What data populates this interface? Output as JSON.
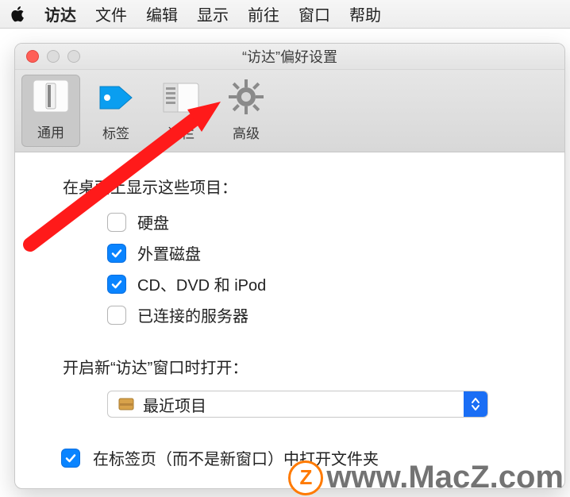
{
  "menubar": {
    "app": "访达",
    "items": [
      "文件",
      "编辑",
      "显示",
      "前往",
      "窗口",
      "帮助"
    ]
  },
  "window": {
    "title": "“访达”偏好设置"
  },
  "toolbar": {
    "general": "通用",
    "tags": "标签",
    "sidebar": "边栏",
    "advanced": "高级"
  },
  "desktop": {
    "heading": "在桌面上显示这些项目：",
    "items": [
      {
        "label": "硬盘",
        "checked": false
      },
      {
        "label": "外置磁盘",
        "checked": true
      },
      {
        "label": "CD、DVD 和 iPod",
        "checked": true
      },
      {
        "label": "已连接的服务器",
        "checked": false
      }
    ]
  },
  "newwindow": {
    "heading": "开启新“访达”窗口时打开：",
    "selected": "最近项目"
  },
  "tabsOption": {
    "label": "在标签页（而不是新窗口）中打开文件夹",
    "checked": true
  },
  "watermark": "www.MacZ.com"
}
